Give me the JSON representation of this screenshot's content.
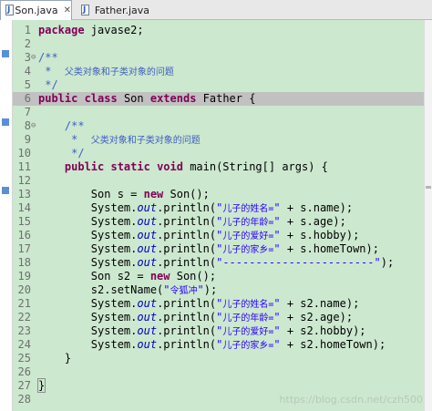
{
  "tabs": [
    {
      "label": "Son.java",
      "close": "✕",
      "active": true
    },
    {
      "label": "Father.java",
      "active": false
    }
  ],
  "code_lines": [
    {
      "n": "1",
      "fold": "",
      "segments": [
        {
          "t": "package ",
          "c": "kw"
        },
        {
          "t": "javase2;",
          "c": ""
        }
      ]
    },
    {
      "n": "2",
      "fold": "",
      "segments": []
    },
    {
      "n": "3",
      "fold": "⊖",
      "segments": [
        {
          "t": "/**",
          "c": "cm"
        }
      ]
    },
    {
      "n": "4",
      "fold": "",
      "segments": [
        {
          "t": " *  ",
          "c": "cm"
        },
        {
          "t": "父类对象和子类对象的问题",
          "c": "cm cn"
        }
      ]
    },
    {
      "n": "5",
      "fold": "",
      "segments": [
        {
          "t": " */",
          "c": "cm"
        }
      ]
    },
    {
      "n": "6",
      "fold": "",
      "current": true,
      "segments": [
        {
          "t": "public ",
          "c": "kw"
        },
        {
          "t": "class ",
          "c": "kw"
        },
        {
          "t": "Son ",
          "c": ""
        },
        {
          "t": "extends ",
          "c": "kw"
        },
        {
          "t": "Father {",
          "c": ""
        }
      ]
    },
    {
      "n": "7",
      "fold": "",
      "segments": []
    },
    {
      "n": "8",
      "fold": "⊖",
      "segments": [
        {
          "t": "    /**",
          "c": "cm"
        }
      ]
    },
    {
      "n": "9",
      "fold": "",
      "segments": [
        {
          "t": "     *  ",
          "c": "cm"
        },
        {
          "t": "父类对象和子类对象的问题",
          "c": "cm cn"
        }
      ]
    },
    {
      "n": "10",
      "fold": "",
      "segments": [
        {
          "t": "     */",
          "c": "cm"
        }
      ]
    },
    {
      "n": "11",
      "fold": "",
      "segments": [
        {
          "t": "    public ",
          "c": "kw"
        },
        {
          "t": "static ",
          "c": "kw"
        },
        {
          "t": "void ",
          "c": "kw"
        },
        {
          "t": "main(String[] args) {",
          "c": ""
        }
      ]
    },
    {
      "n": "12",
      "fold": "",
      "segments": []
    },
    {
      "n": "13",
      "fold": "",
      "segments": [
        {
          "t": "        Son s = ",
          "c": ""
        },
        {
          "t": "new ",
          "c": "kw"
        },
        {
          "t": "Son();",
          "c": ""
        }
      ]
    },
    {
      "n": "14",
      "fold": "",
      "segments": [
        {
          "t": "        System.",
          "c": ""
        },
        {
          "t": "out",
          "c": "fi"
        },
        {
          "t": ".println(",
          "c": ""
        },
        {
          "t": "\"",
          "c": "st"
        },
        {
          "t": "儿子的姓名=",
          "c": "st cn"
        },
        {
          "t": "\"",
          "c": "st"
        },
        {
          "t": " + s.name);",
          "c": ""
        }
      ]
    },
    {
      "n": "15",
      "fold": "",
      "segments": [
        {
          "t": "        System.",
          "c": ""
        },
        {
          "t": "out",
          "c": "fi"
        },
        {
          "t": ".println(",
          "c": ""
        },
        {
          "t": "\"",
          "c": "st"
        },
        {
          "t": "儿子的年龄=",
          "c": "st cn"
        },
        {
          "t": "\"",
          "c": "st"
        },
        {
          "t": " + s.age);",
          "c": ""
        }
      ]
    },
    {
      "n": "16",
      "fold": "",
      "segments": [
        {
          "t": "        System.",
          "c": ""
        },
        {
          "t": "out",
          "c": "fi"
        },
        {
          "t": ".println(",
          "c": ""
        },
        {
          "t": "\"",
          "c": "st"
        },
        {
          "t": "儿子的爱好=",
          "c": "st cn"
        },
        {
          "t": "\"",
          "c": "st"
        },
        {
          "t": " + s.hobby);",
          "c": ""
        }
      ]
    },
    {
      "n": "17",
      "fold": "",
      "segments": [
        {
          "t": "        System.",
          "c": ""
        },
        {
          "t": "out",
          "c": "fi"
        },
        {
          "t": ".println(",
          "c": ""
        },
        {
          "t": "\"",
          "c": "st"
        },
        {
          "t": "儿子的家乡=",
          "c": "st cn"
        },
        {
          "t": "\"",
          "c": "st"
        },
        {
          "t": " + s.homeTown);",
          "c": ""
        }
      ]
    },
    {
      "n": "18",
      "fold": "",
      "segments": [
        {
          "t": "        System.",
          "c": ""
        },
        {
          "t": "out",
          "c": "fi"
        },
        {
          "t": ".println(",
          "c": ""
        },
        {
          "t": "\"-----------------------\"",
          "c": "st"
        },
        {
          "t": ");",
          "c": ""
        }
      ]
    },
    {
      "n": "19",
      "fold": "",
      "segments": [
        {
          "t": "        Son s2 = ",
          "c": ""
        },
        {
          "t": "new ",
          "c": "kw"
        },
        {
          "t": "Son();",
          "c": ""
        }
      ]
    },
    {
      "n": "20",
      "fold": "",
      "segments": [
        {
          "t": "        s2.setName(",
          "c": ""
        },
        {
          "t": "\"",
          "c": "st"
        },
        {
          "t": "令狐冲",
          "c": "st cn"
        },
        {
          "t": "\"",
          "c": "st"
        },
        {
          "t": ");",
          "c": ""
        }
      ]
    },
    {
      "n": "21",
      "fold": "",
      "segments": [
        {
          "t": "        System.",
          "c": ""
        },
        {
          "t": "out",
          "c": "fi"
        },
        {
          "t": ".println(",
          "c": ""
        },
        {
          "t": "\"",
          "c": "st"
        },
        {
          "t": "儿子的姓名=",
          "c": "st cn"
        },
        {
          "t": "\"",
          "c": "st"
        },
        {
          "t": " + s2.name);",
          "c": ""
        }
      ]
    },
    {
      "n": "22",
      "fold": "",
      "segments": [
        {
          "t": "        System.",
          "c": ""
        },
        {
          "t": "out",
          "c": "fi"
        },
        {
          "t": ".println(",
          "c": ""
        },
        {
          "t": "\"",
          "c": "st"
        },
        {
          "t": "儿子的年龄=",
          "c": "st cn"
        },
        {
          "t": "\"",
          "c": "st"
        },
        {
          "t": " + s2.age);",
          "c": ""
        }
      ]
    },
    {
      "n": "23",
      "fold": "",
      "segments": [
        {
          "t": "        System.",
          "c": ""
        },
        {
          "t": "out",
          "c": "fi"
        },
        {
          "t": ".println(",
          "c": ""
        },
        {
          "t": "\"",
          "c": "st"
        },
        {
          "t": "儿子的爱好=",
          "c": "st cn"
        },
        {
          "t": "\"",
          "c": "st"
        },
        {
          "t": " + s2.hobby);",
          "c": ""
        }
      ]
    },
    {
      "n": "24",
      "fold": "",
      "segments": [
        {
          "t": "        System.",
          "c": ""
        },
        {
          "t": "out",
          "c": "fi"
        },
        {
          "t": ".println(",
          "c": ""
        },
        {
          "t": "\"",
          "c": "st"
        },
        {
          "t": "儿子的家乡=",
          "c": "st cn"
        },
        {
          "t": "\"",
          "c": "st"
        },
        {
          "t": " + s2.homeTown);",
          "c": ""
        }
      ]
    },
    {
      "n": "25",
      "fold": "",
      "segments": [
        {
          "t": "    }",
          "c": ""
        }
      ]
    },
    {
      "n": "26",
      "fold": "",
      "segments": []
    },
    {
      "n": "27",
      "fold": "",
      "segments": [
        {
          "t": "}",
          "c": "brace-box"
        }
      ]
    },
    {
      "n": "28",
      "fold": "",
      "segments": []
    }
  ],
  "watermark": "https://blog.csdn.net/czh500",
  "colors": {
    "editor_bg": "#cce8cf",
    "keyword": "#7f0055",
    "comment": "#3f5fbf",
    "string": "#2a00ff",
    "field": "#0000c0",
    "current_line": "#c1c1c1"
  }
}
